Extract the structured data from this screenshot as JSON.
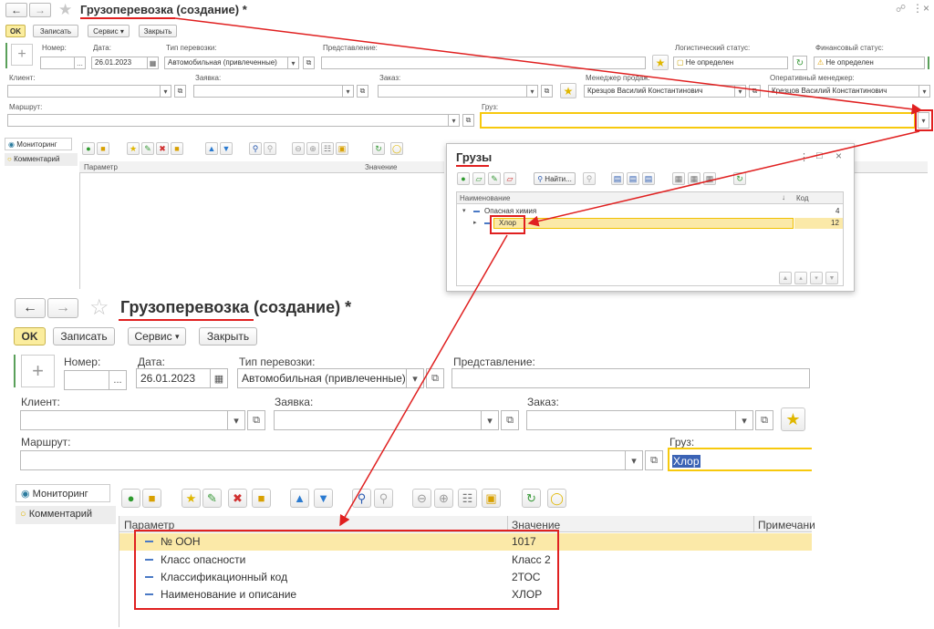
{
  "colors": {
    "accent": "#f7c90d",
    "annotation": "#e02020",
    "selection_bg": "#fbe9a8",
    "link_blue": "#4a79c5"
  },
  "small_form": {
    "title": "Грузоперевозка (создание) *",
    "toolbar": {
      "ok": "OK",
      "save": "Записать",
      "service": "Сервис",
      "close": "Закрыть"
    },
    "fields": {
      "number_label": "Номер:",
      "number_value": "",
      "date_label": "Дата:",
      "date_value": "26.01.2023",
      "transport_type_label": "Тип перевозки:",
      "transport_type_value": "Автомобильная (привлеченные)",
      "representation_label": "Представление:",
      "representation_value": "",
      "log_status_label": "Логистический статус:",
      "log_status_value": "Не определен",
      "fin_status_label": "Финансовый статус:",
      "fin_status_value": "Не определен",
      "client_label": "Клиент:",
      "request_label": "Заявка:",
      "order_label": "Заказ:",
      "sales_manager_label": "Менеджер продаж:",
      "sales_manager_value": "Крезцов Василий Константинович",
      "op_manager_label": "Оперативный менеджер:",
      "op_manager_value": "Крезцов Василий Константинович",
      "route_label": "Маршрут:",
      "cargo_label": "Груз:",
      "cargo_value": ""
    },
    "tabs": [
      "Мониторинг",
      "Комментарий"
    ],
    "table_headers": [
      "Параметр",
      "Значение"
    ]
  },
  "popup": {
    "title": "Грузы",
    "find_label": "Найти...",
    "headers": [
      "Наименование",
      "Код"
    ],
    "rows": [
      {
        "name": "Опасная химия",
        "code": "4"
      },
      {
        "name": "Хлор",
        "code": "12"
      }
    ]
  },
  "big_form": {
    "title": "Грузоперевозка (создание) *",
    "toolbar": {
      "ok": "OK",
      "save": "Записать",
      "service": "Сервис",
      "close": "Закрыть"
    },
    "fields": {
      "number_label": "Номер:",
      "number_value": "",
      "date_label": "Дата:",
      "date_value": "26.01.2023",
      "transport_type_label": "Тип перевозки:",
      "transport_type_value": "Автомобильная (привлеченные)",
      "representation_label": "Представление:",
      "client_label": "Клиент:",
      "request_label": "Заявка:",
      "order_label": "Заказ:",
      "route_label": "Маршрут:",
      "cargo_label": "Груз:",
      "cargo_value": "Хлор"
    },
    "tabs": [
      "Мониторинг",
      "Комментарий"
    ],
    "table_headers": [
      "Параметр",
      "Значение",
      "Примечани"
    ],
    "rows": [
      {
        "param": "№ ООН",
        "value": "1017"
      },
      {
        "param": "Класс опасности",
        "value": "Класс 2"
      },
      {
        "param": "Классификационный код",
        "value": "2ТОС"
      },
      {
        "param": "Наименование и описание",
        "value": "ХЛОР"
      }
    ]
  }
}
